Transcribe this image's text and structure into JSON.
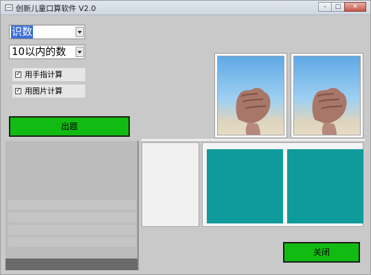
{
  "window": {
    "title": "创新儿童口算软件 V2.0",
    "controls": {
      "minimize": "–",
      "maximize": "□",
      "close": "✕"
    }
  },
  "mode_select": {
    "value": "识数",
    "icon": "chevron-down-icon"
  },
  "range_select": {
    "value": "10以内的数",
    "icon": "chevron-down-icon"
  },
  "options": [
    {
      "label": "用手指计算",
      "checked": true,
      "mark": "✓"
    },
    {
      "label": "用图片计算",
      "checked": true,
      "mark": "✓"
    }
  ],
  "actions": {
    "generate_label": "出题",
    "close_label": "关闭"
  },
  "colors": {
    "button_green": "#11bb11",
    "answer_teal": "#0f9b9b",
    "select_highlight": "#3b6fd5",
    "sky_blue": "#5fa9e6"
  },
  "images": {
    "left_hand": "fist-hand-image",
    "right_hand": "fist-hand-image"
  }
}
